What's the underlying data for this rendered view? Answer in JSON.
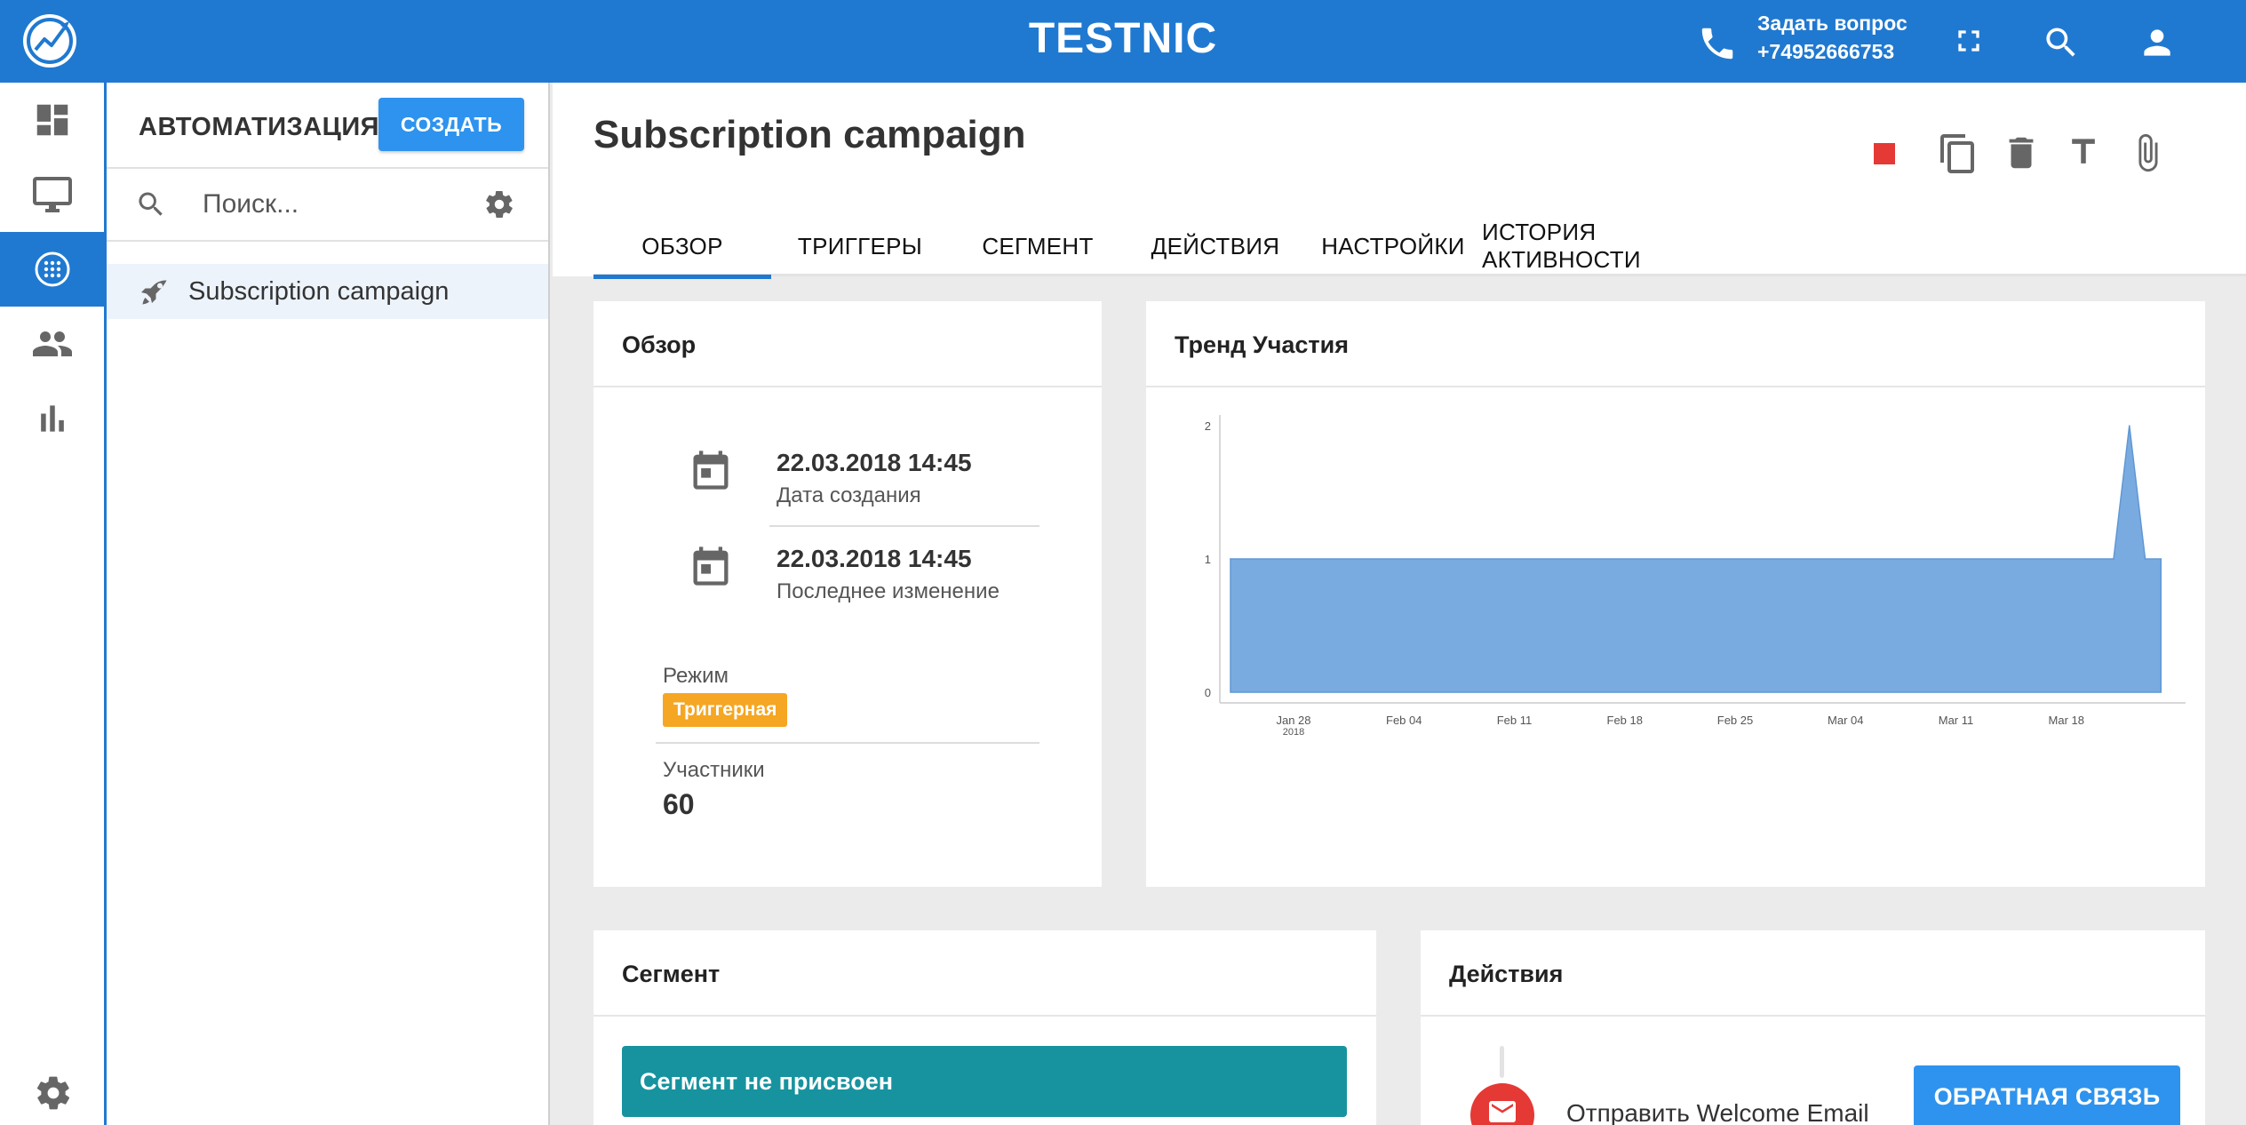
{
  "header": {
    "brand": "TESTNIC",
    "contact_title": "Задать вопрос",
    "contact_phone": "+74952666753",
    "bar_color": "#2079d0",
    "icons": [
      "logo-icon",
      "phone-icon",
      "fullscreen-icon",
      "search-icon",
      "account-icon"
    ]
  },
  "rail": {
    "items": [
      {
        "icon": "dashboard-icon",
        "active": false
      },
      {
        "icon": "monitor-icon",
        "active": false
      },
      {
        "icon": "automation-icon",
        "active": true
      },
      {
        "icon": "people-icon",
        "active": false
      },
      {
        "icon": "bar-chart-icon",
        "active": false
      }
    ],
    "bottom_icon": "settings-icon"
  },
  "panel": {
    "title": "АВТОМАТИЗАЦИЯ",
    "create_label": "СОЗДАТЬ",
    "search_placeholder": "Поиск...",
    "items": [
      {
        "icon": "rocket-icon",
        "label": "Subscription campaign"
      }
    ]
  },
  "campaign": {
    "title": "Subscription campaign",
    "actions": [
      "stop-icon",
      "copy-icon",
      "delete-icon",
      "rename-icon",
      "attach-icon"
    ],
    "stop_color": "#e53935",
    "tabs": [
      {
        "label": "ОБЗОР",
        "active": true
      },
      {
        "label": "ТРИГГЕРЫ",
        "active": false
      },
      {
        "label": "СЕГМЕНТ",
        "active": false
      },
      {
        "label": "ДЕЙСТВИЯ",
        "active": false
      },
      {
        "label": "НАСТРОЙКИ",
        "active": false
      },
      {
        "label": "ИСТОРИЯ АКТИВНОСТИ",
        "active": false
      }
    ]
  },
  "overview": {
    "title": "Обзор",
    "created_value": "22.03.2018 14:45",
    "created_label": "Дата создания",
    "modified_value": "22.03.2018 14:45",
    "modified_label": "Последнее изменение",
    "mode_label": "Режим",
    "mode_value": "Триггерная",
    "mode_color": "#f5a623",
    "participants_label": "Участники",
    "participants_value": "60"
  },
  "trend": {
    "title": "Тренд Участия"
  },
  "chart_data": {
    "type": "area",
    "title": "",
    "xlabel": "",
    "ylabel": "",
    "ylim": [
      0,
      2
    ],
    "yticks": [
      "0",
      "1",
      "2"
    ],
    "xticks": [
      "Jan 28",
      "Feb 04",
      "Feb 11",
      "Feb 18",
      "Feb 25",
      "Mar 04",
      "Mar 11",
      "Mar 18"
    ],
    "x_year_label": "2018",
    "x_start": "2018-01-24",
    "x_end": "2018-03-25",
    "series": [
      {
        "color": "#7aabe0",
        "points": [
          {
            "x": "2018-01-24",
            "y": 1
          },
          {
            "x": "2018-03-21",
            "y": 1
          },
          {
            "x": "2018-03-22",
            "y": 2
          },
          {
            "x": "2018-03-23",
            "y": 1
          },
          {
            "x": "2018-03-24",
            "y": 1
          }
        ]
      }
    ],
    "grid": false,
    "legend": "none"
  },
  "segment": {
    "title": "Сегмент",
    "empty_text": "Сегмент не присвоен",
    "box_color": "#17939f"
  },
  "actions_card": {
    "title": "Действия",
    "items": [
      {
        "icon": "email-icon",
        "label": "Отправить Welcome Email"
      }
    ]
  },
  "feedback": {
    "label": "ОБРАТНАЯ СВЯЗЬ"
  }
}
